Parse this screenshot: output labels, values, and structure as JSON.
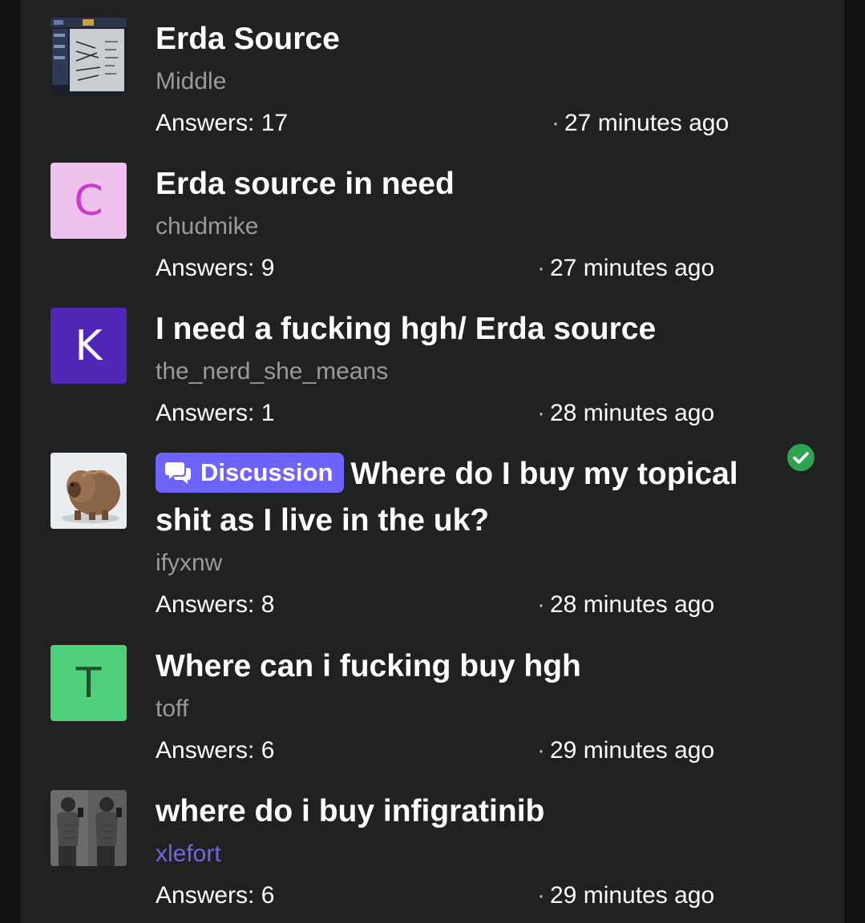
{
  "posts": [
    {
      "title": "Erda Source",
      "author": "Middle",
      "answers": "Answers: 17",
      "time": "27 minutes ago",
      "avatar": {
        "type": "image",
        "icon": "whiteboard-photo-thumbnail"
      }
    },
    {
      "title": "Erda source in need",
      "author": "chudmike",
      "answers": "Answers: 9",
      "time": "27 minutes ago",
      "avatar": {
        "type": "letter",
        "letter": "C",
        "bg": "#f0c0ee",
        "fg": "#c73ccd"
      }
    },
    {
      "title": "I need a fucking hgh/ Erda source",
      "author": "the_nerd_she_means",
      "answers": "Answers: 1",
      "time": "28 minutes ago",
      "avatar": {
        "type": "letter",
        "letter": "K",
        "bg": "#5226b7",
        "fg": "#ffffff"
      }
    },
    {
      "badge": "Discussion",
      "badge_icon": "chat-bubbles-icon",
      "title": "Where do I buy my topical shit as I live in the uk?",
      "author": "ifyxnw",
      "answers": "Answers: 8",
      "time": "28 minutes ago",
      "solved_icon": "check-circle-icon",
      "avatar": {
        "type": "image",
        "icon": "furry-animal-photo"
      }
    },
    {
      "title": "Where can i fucking buy hgh",
      "author": "toff",
      "answers": "Answers: 6",
      "time": "29 minutes ago",
      "avatar": {
        "type": "letter",
        "letter": "T",
        "bg": "#4fd17c",
        "fg": "#1f4f2e"
      }
    },
    {
      "title": "where do i buy infigratinib",
      "author": "xlefort",
      "answers": "Answers: 6",
      "time": "29 minutes ago",
      "avatar": {
        "type": "image",
        "icon": "mirror-selfie-photo"
      }
    }
  ],
  "colors": {
    "panel": "#212121",
    "page": "#131313",
    "badge": "#6d63ff",
    "check": "#2ea44f",
    "link_author": "#6a6ae0"
  }
}
